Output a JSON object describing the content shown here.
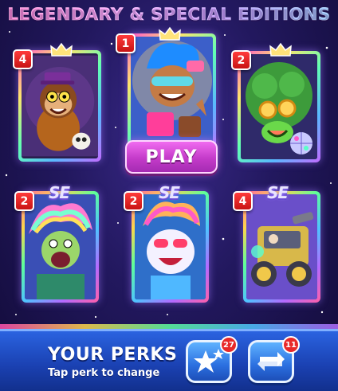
{
  "header": {
    "title": "LEGENDARY & SPECIAL EDITIONS"
  },
  "cards": [
    {
      "level": "4",
      "tag": "crown",
      "character": "monkey-wizard"
    },
    {
      "level": "1",
      "tag": "crown",
      "character": "blue-hair-hero",
      "selected": true
    },
    {
      "level": "2",
      "tag": "crown",
      "character": "afro-disco"
    },
    {
      "level": "2",
      "tag": "SE",
      "character": "rainbow-hair-scream"
    },
    {
      "level": "2",
      "tag": "SE",
      "character": "rainbow-cat"
    },
    {
      "level": "4",
      "tag": "SE",
      "character": "gold-tank"
    }
  ],
  "play_button": {
    "label": "PLAY"
  },
  "perks": {
    "title": "YOUR PERKS",
    "subtitle": "Tap perk to change",
    "items": [
      {
        "icon": "stars-icon",
        "count": "27"
      },
      {
        "icon": "swap-arrows-icon",
        "count": "11"
      }
    ]
  },
  "colors": {
    "badge": "#e02020",
    "play": "#d04fd4",
    "perks_bar": "#1f4fcc"
  }
}
